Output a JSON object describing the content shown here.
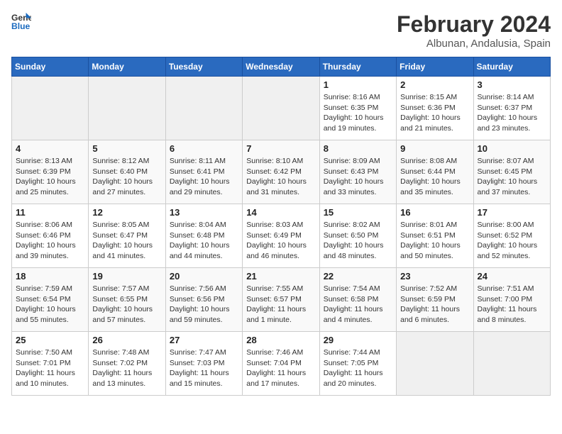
{
  "logo": {
    "line1": "General",
    "line2": "Blue"
  },
  "title": "February 2024",
  "subtitle": "Albunan, Andalusia, Spain",
  "weekdays": [
    "Sunday",
    "Monday",
    "Tuesday",
    "Wednesday",
    "Thursday",
    "Friday",
    "Saturday"
  ],
  "weeks": [
    [
      {
        "day": "",
        "info": ""
      },
      {
        "day": "",
        "info": ""
      },
      {
        "day": "",
        "info": ""
      },
      {
        "day": "",
        "info": ""
      },
      {
        "day": "1",
        "info": "Sunrise: 8:16 AM\nSunset: 6:35 PM\nDaylight: 10 hours\nand 19 minutes."
      },
      {
        "day": "2",
        "info": "Sunrise: 8:15 AM\nSunset: 6:36 PM\nDaylight: 10 hours\nand 21 minutes."
      },
      {
        "day": "3",
        "info": "Sunrise: 8:14 AM\nSunset: 6:37 PM\nDaylight: 10 hours\nand 23 minutes."
      }
    ],
    [
      {
        "day": "4",
        "info": "Sunrise: 8:13 AM\nSunset: 6:39 PM\nDaylight: 10 hours\nand 25 minutes."
      },
      {
        "day": "5",
        "info": "Sunrise: 8:12 AM\nSunset: 6:40 PM\nDaylight: 10 hours\nand 27 minutes."
      },
      {
        "day": "6",
        "info": "Sunrise: 8:11 AM\nSunset: 6:41 PM\nDaylight: 10 hours\nand 29 minutes."
      },
      {
        "day": "7",
        "info": "Sunrise: 8:10 AM\nSunset: 6:42 PM\nDaylight: 10 hours\nand 31 minutes."
      },
      {
        "day": "8",
        "info": "Sunrise: 8:09 AM\nSunset: 6:43 PM\nDaylight: 10 hours\nand 33 minutes."
      },
      {
        "day": "9",
        "info": "Sunrise: 8:08 AM\nSunset: 6:44 PM\nDaylight: 10 hours\nand 35 minutes."
      },
      {
        "day": "10",
        "info": "Sunrise: 8:07 AM\nSunset: 6:45 PM\nDaylight: 10 hours\nand 37 minutes."
      }
    ],
    [
      {
        "day": "11",
        "info": "Sunrise: 8:06 AM\nSunset: 6:46 PM\nDaylight: 10 hours\nand 39 minutes."
      },
      {
        "day": "12",
        "info": "Sunrise: 8:05 AM\nSunset: 6:47 PM\nDaylight: 10 hours\nand 41 minutes."
      },
      {
        "day": "13",
        "info": "Sunrise: 8:04 AM\nSunset: 6:48 PM\nDaylight: 10 hours\nand 44 minutes."
      },
      {
        "day": "14",
        "info": "Sunrise: 8:03 AM\nSunset: 6:49 PM\nDaylight: 10 hours\nand 46 minutes."
      },
      {
        "day": "15",
        "info": "Sunrise: 8:02 AM\nSunset: 6:50 PM\nDaylight: 10 hours\nand 48 minutes."
      },
      {
        "day": "16",
        "info": "Sunrise: 8:01 AM\nSunset: 6:51 PM\nDaylight: 10 hours\nand 50 minutes."
      },
      {
        "day": "17",
        "info": "Sunrise: 8:00 AM\nSunset: 6:52 PM\nDaylight: 10 hours\nand 52 minutes."
      }
    ],
    [
      {
        "day": "18",
        "info": "Sunrise: 7:59 AM\nSunset: 6:54 PM\nDaylight: 10 hours\nand 55 minutes."
      },
      {
        "day": "19",
        "info": "Sunrise: 7:57 AM\nSunset: 6:55 PM\nDaylight: 10 hours\nand 57 minutes."
      },
      {
        "day": "20",
        "info": "Sunrise: 7:56 AM\nSunset: 6:56 PM\nDaylight: 10 hours\nand 59 minutes."
      },
      {
        "day": "21",
        "info": "Sunrise: 7:55 AM\nSunset: 6:57 PM\nDaylight: 11 hours\nand 1 minute."
      },
      {
        "day": "22",
        "info": "Sunrise: 7:54 AM\nSunset: 6:58 PM\nDaylight: 11 hours\nand 4 minutes."
      },
      {
        "day": "23",
        "info": "Sunrise: 7:52 AM\nSunset: 6:59 PM\nDaylight: 11 hours\nand 6 minutes."
      },
      {
        "day": "24",
        "info": "Sunrise: 7:51 AM\nSunset: 7:00 PM\nDaylight: 11 hours\nand 8 minutes."
      }
    ],
    [
      {
        "day": "25",
        "info": "Sunrise: 7:50 AM\nSunset: 7:01 PM\nDaylight: 11 hours\nand 10 minutes."
      },
      {
        "day": "26",
        "info": "Sunrise: 7:48 AM\nSunset: 7:02 PM\nDaylight: 11 hours\nand 13 minutes."
      },
      {
        "day": "27",
        "info": "Sunrise: 7:47 AM\nSunset: 7:03 PM\nDaylight: 11 hours\nand 15 minutes."
      },
      {
        "day": "28",
        "info": "Sunrise: 7:46 AM\nSunset: 7:04 PM\nDaylight: 11 hours\nand 17 minutes."
      },
      {
        "day": "29",
        "info": "Sunrise: 7:44 AM\nSunset: 7:05 PM\nDaylight: 11 hours\nand 20 minutes."
      },
      {
        "day": "",
        "info": ""
      },
      {
        "day": "",
        "info": ""
      }
    ]
  ]
}
